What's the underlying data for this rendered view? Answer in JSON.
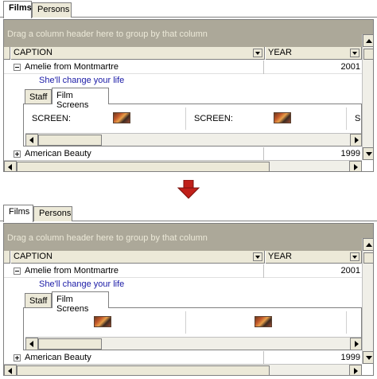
{
  "screens": [
    {
      "tabs": [
        "Films",
        "Persons"
      ],
      "active_tab": "Films",
      "group_panel_text": "Drag a column header here to group by that column",
      "columns": [
        "CAPTION",
        "YEAR"
      ],
      "rows": [
        {
          "caption": "Amelie from Montmartre",
          "year": "2001",
          "expanded": true,
          "preview": "She'll change your life"
        },
        {
          "caption": "American Beauty",
          "year": "1999",
          "expanded": false
        }
      ],
      "detail_tabs": [
        "Staff",
        "Film Screens"
      ],
      "active_detail_tab": "Film Screens",
      "screen_cells": [
        "SCREEN:",
        "SCREEN:",
        "SC"
      ]
    },
    {
      "tabs": [
        "Films",
        "Persons"
      ],
      "active_tab": "Films",
      "group_panel_text": "Drag a column header here to group by that column",
      "columns": [
        "CAPTION",
        "YEAR"
      ],
      "rows": [
        {
          "caption": "Amelie from Montmartre",
          "year": "2001",
          "expanded": true,
          "preview": "She'll change your life"
        },
        {
          "caption": "American Beauty",
          "year": "1999",
          "expanded": false
        }
      ],
      "detail_tabs": [
        "Staff",
        "Film Screens"
      ],
      "active_detail_tab": "Film Screens",
      "screen_cells": [
        "",
        "",
        ""
      ]
    }
  ],
  "transition_icon": "red-down-arrow-icon",
  "colors": {
    "arrow": "#c0201a",
    "group_panel": "#aca899",
    "preview_text": "#1a1aa6"
  }
}
